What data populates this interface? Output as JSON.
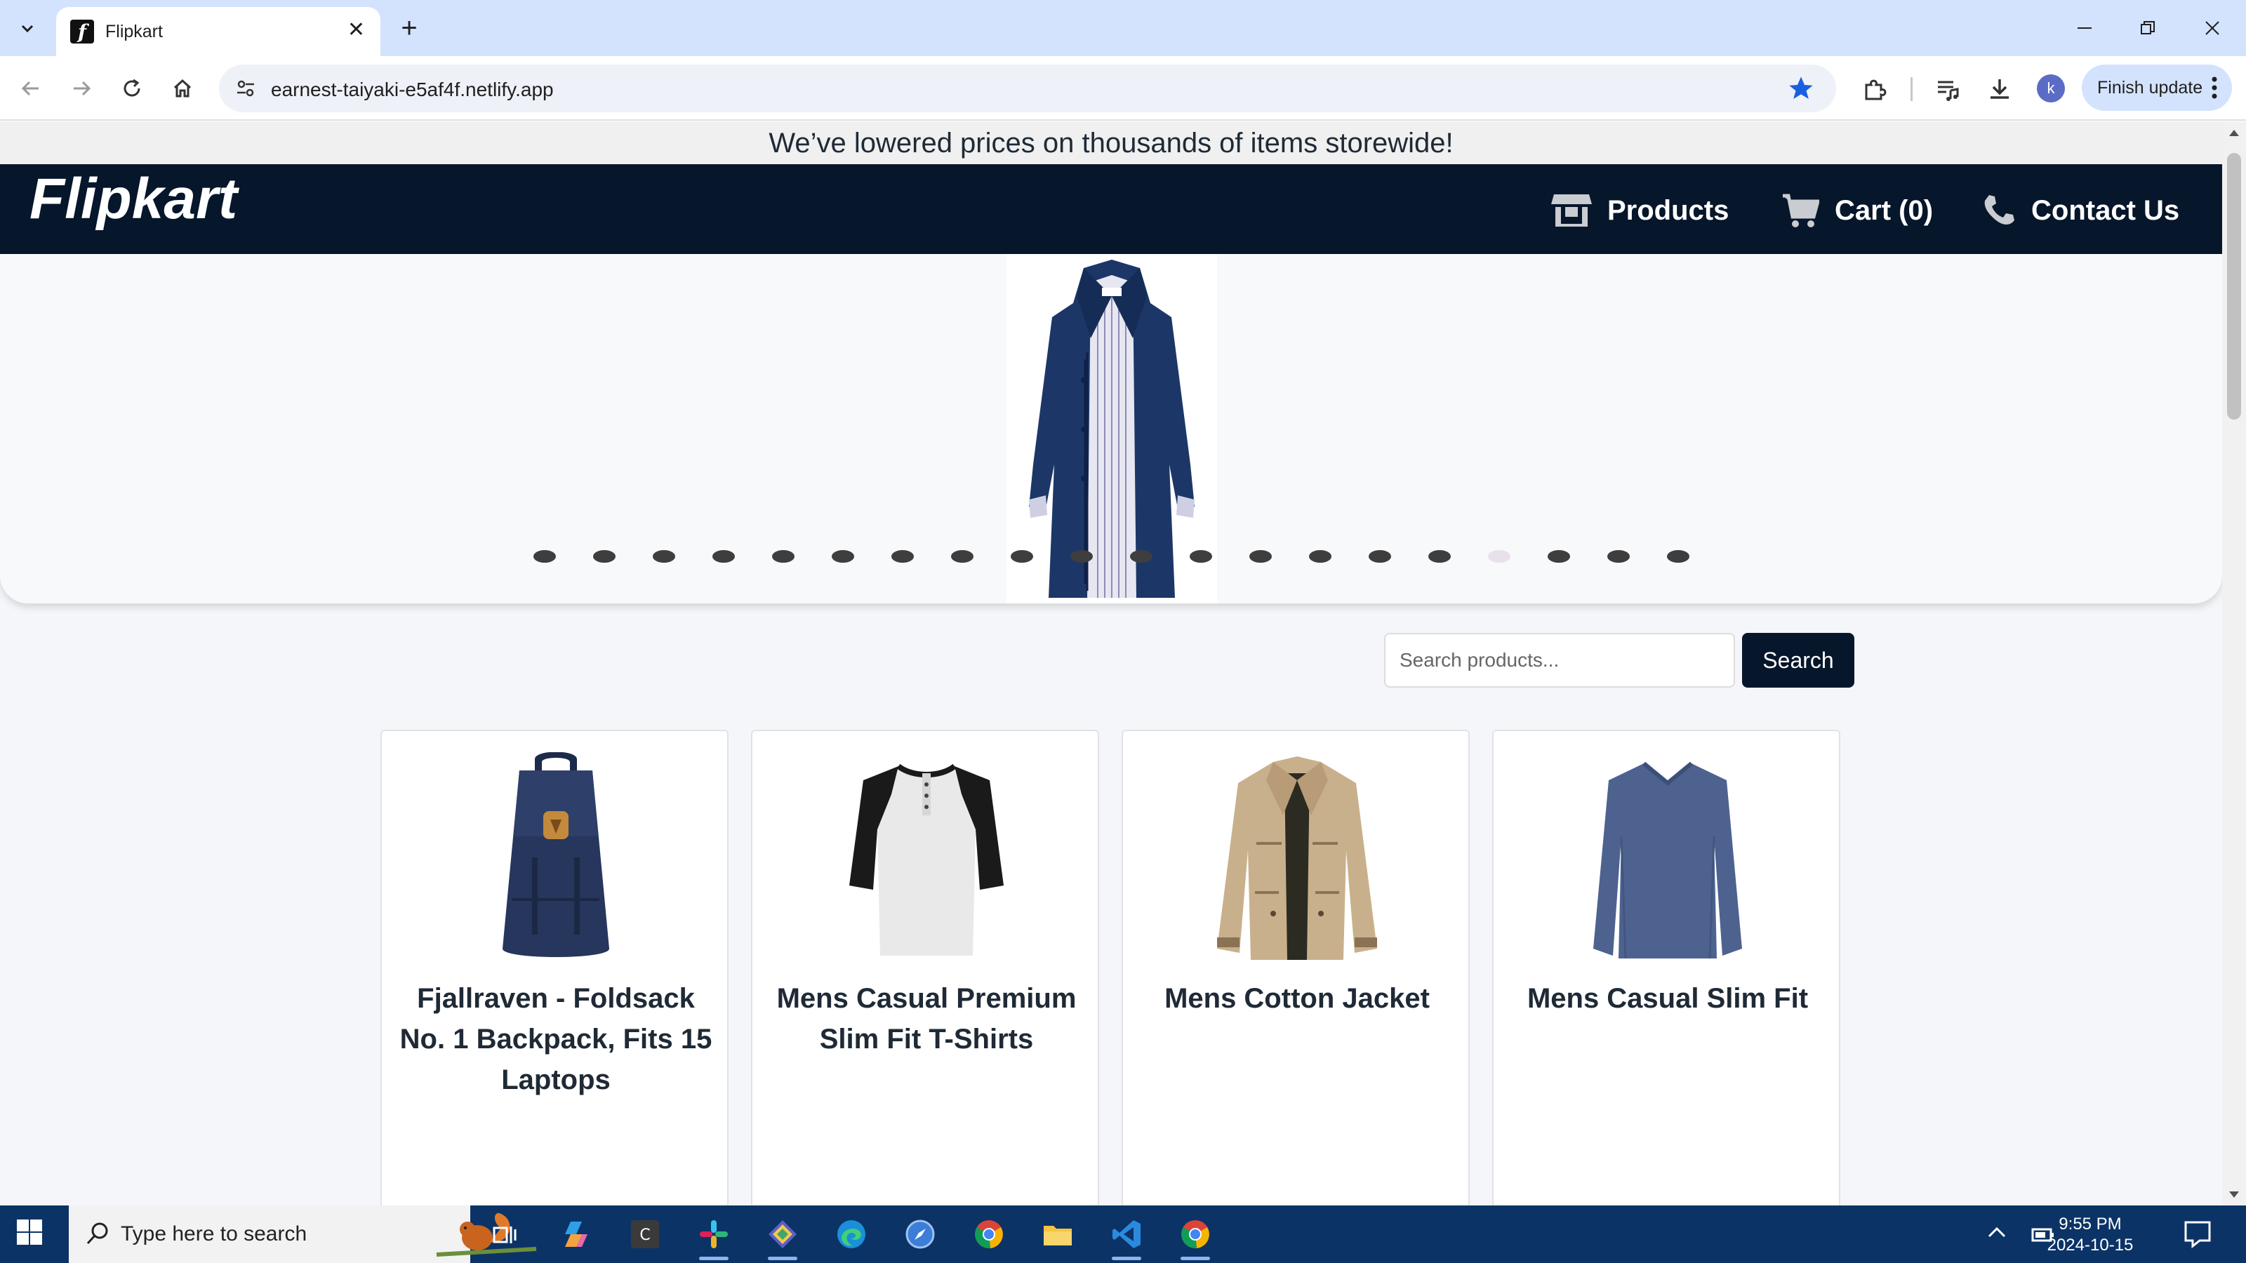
{
  "browser": {
    "tab_title": "Flipkart",
    "url": "earnest-taiyaki-e5af4f.netlify.app",
    "profile_initial": "k",
    "finish_update_label": "Finish update"
  },
  "page": {
    "announcement": "We’ve lowered prices on thousands of items storewide!",
    "logo": "Flipkart",
    "nav": {
      "products": "Products",
      "cart": "Cart (0)",
      "contact": "Contact Us"
    },
    "carousel": {
      "dot_count": 20,
      "active_dot": 16
    },
    "search": {
      "placeholder": "Search products...",
      "button": "Search"
    },
    "products": [
      {
        "title": "Fjallraven - Foldsack No. 1 Backpack, Fits 15 Laptops",
        "image": "backpack"
      },
      {
        "title": "Mens Casual Premium Slim Fit T-Shirts",
        "image": "raglan-tshirt"
      },
      {
        "title": "Mens Cotton Jacket",
        "image": "cotton-jacket"
      },
      {
        "title": "Mens Casual Slim Fit",
        "image": "long-sleeve-shirt"
      }
    ]
  },
  "taskbar": {
    "search_placeholder": "Type here to search",
    "time": "9:55 PM",
    "date": "2024-10-15"
  },
  "colors": {
    "header_bg": "#06162b",
    "tabbar_bg": "#d3e3fd",
    "taskbar_bg": "#0c3366",
    "star": "#1a5fe0"
  }
}
